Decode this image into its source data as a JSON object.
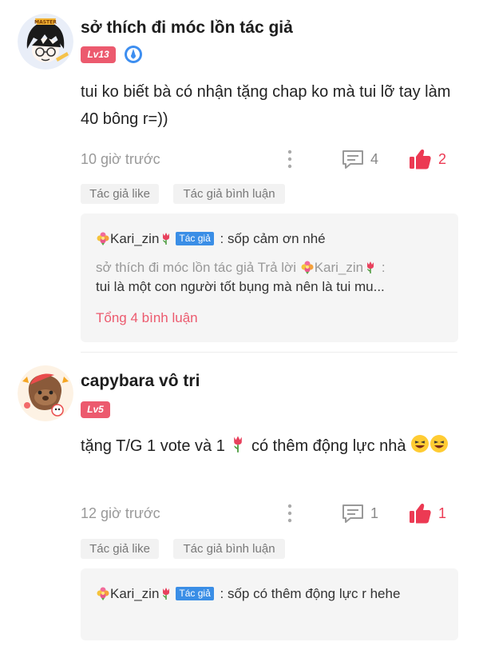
{
  "comments": [
    {
      "username": "sở thích đi móc lồn tác giả",
      "level": "Lv13",
      "content": "tui ko biết bà có nhận tặng chap ko mà tui lỡ tay làm 40 bông r=))",
      "time": "10 giờ trước",
      "reply_count": "4",
      "like_count": "2",
      "tags": [
        "Tác giả like",
        "Tác giả bình luận"
      ],
      "replies": [
        {
          "author": "Kari_zin",
          "badge": "Tác giả",
          "sep": " : ",
          "text": "sốp cảm ơn nhé"
        },
        {
          "author": "sở thích đi móc lồn tác giả",
          "verb": "Trả lời",
          "target": "Kari_zin",
          "sep": " : ",
          "text": "tui là một con người tốt bụng mà nên là tui mu..."
        }
      ],
      "total_label": "Tổng 4 bình luận"
    },
    {
      "username": "capybara vô tri",
      "level": "Lv5",
      "content_part1": "tặng T/G 1 vote và 1",
      "content_part2": "có thêm động lực nhà",
      "time": "12 giờ trước",
      "reply_count": "1",
      "like_count": "1",
      "tags": [
        "Tác giả like",
        "Tác giả bình luận"
      ],
      "replies": [
        {
          "author": "Kari_zin",
          "badge": "Tác giả",
          "sep": " : ",
          "text": "sốp có thêm động lực r hehe"
        }
      ]
    }
  ],
  "colors": {
    "accent": "#ec5a6e",
    "like": "#ec3a53",
    "badge_blue": "#3a8ee6",
    "muted": "#999999"
  },
  "icons": [
    "avatar-1",
    "avatar-2",
    "medal-icon",
    "more-icon",
    "comment-icon",
    "thumbs-up-icon",
    "flower-icon",
    "tulip-icon",
    "laughing-emoji-icon"
  ]
}
